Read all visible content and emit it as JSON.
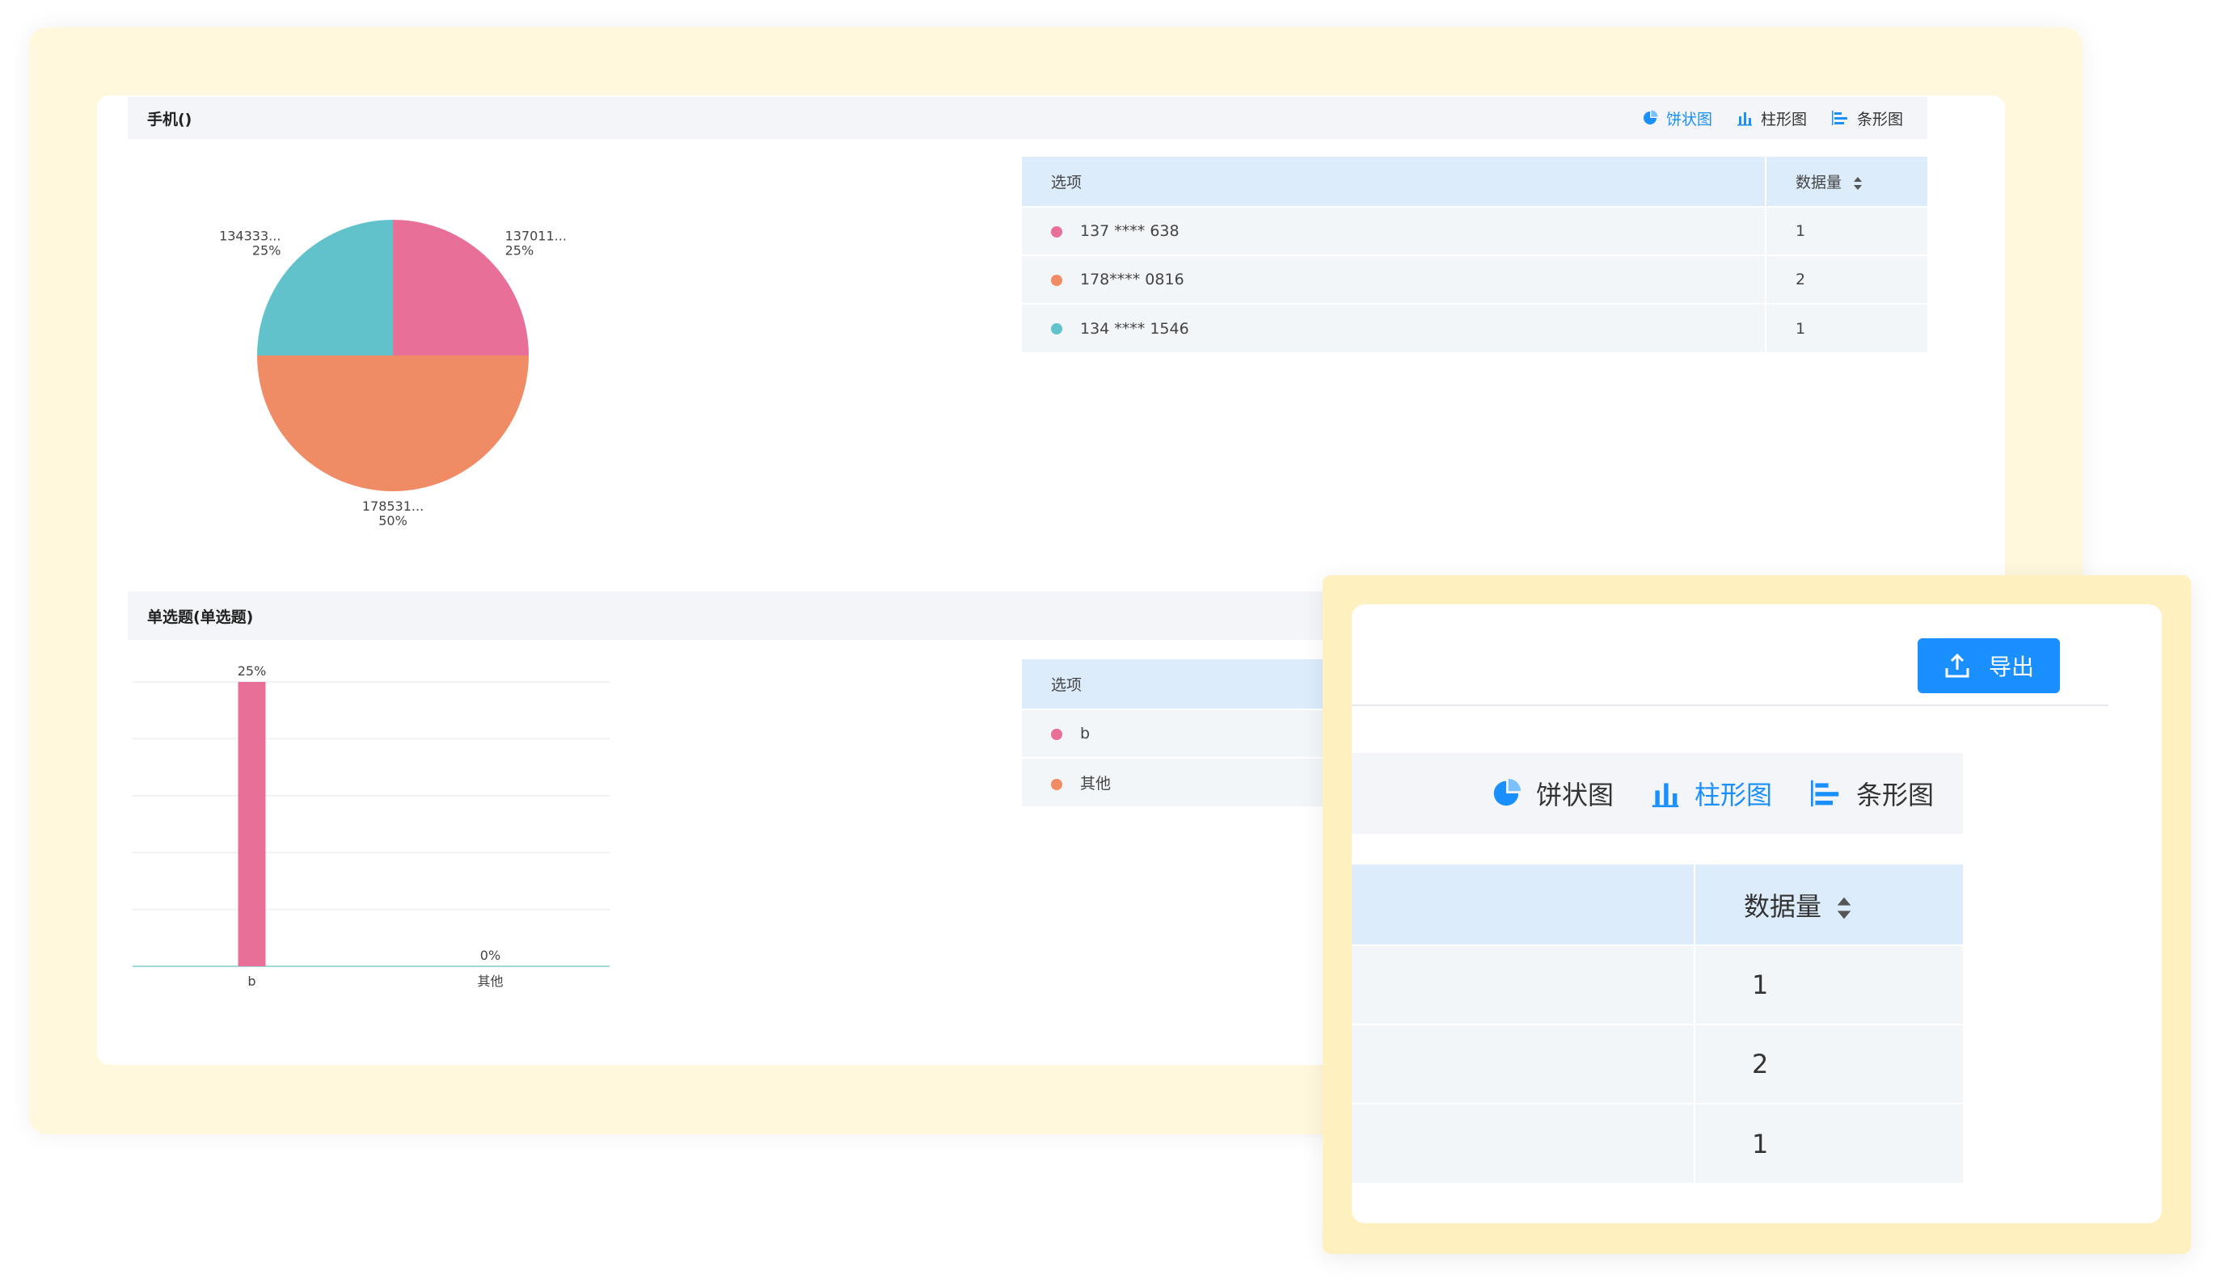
{
  "section1": {
    "title": "手机()",
    "switch": [
      {
        "label": "饼状图",
        "icon": "pie-chart-icon",
        "active": true
      },
      {
        "label": "柱形图",
        "icon": "bar-chart-icon",
        "active": false
      },
      {
        "label": "条形图",
        "icon": "horizontal-bar-icon",
        "active": false
      }
    ],
    "table": {
      "headers": [
        "选项",
        "数据量"
      ],
      "rows": [
        {
          "option": "137 **** 638",
          "count": "1",
          "color": "#e87098"
        },
        {
          "option": "178**** 0816",
          "count": "2",
          "color": "#f08c65"
        },
        {
          "option": "134 **** 1546",
          "count": "1",
          "color": "#62c2cb"
        }
      ]
    }
  },
  "section2": {
    "title": "单选题(单选题)",
    "table": {
      "headers": [
        "选项"
      ],
      "rows": [
        {
          "option": "b",
          "color": "#e87098"
        },
        {
          "option": "其他",
          "color": "#f08c65"
        }
      ]
    }
  },
  "chart_data": [
    {
      "type": "pie",
      "slices": [
        {
          "label": "137011...",
          "percent_label": "25%",
          "value": 25,
          "color": "#e87098"
        },
        {
          "label": "178531...",
          "percent_label": "50%",
          "value": 50,
          "color": "#f08c65"
        },
        {
          "label": "134333...",
          "percent_label": "25%",
          "value": 25,
          "color": "#62c2cb"
        }
      ]
    },
    {
      "type": "bar",
      "categories": [
        "b",
        "其他"
      ],
      "values": [
        25,
        0
      ],
      "data_labels": [
        "25%",
        "0%"
      ],
      "colors": [
        "#e87098",
        "#f08c65"
      ],
      "ylim": [
        0,
        25
      ],
      "grid": true
    }
  ],
  "overlay": {
    "export_label": "导出",
    "switch": [
      {
        "label": "饼状图",
        "icon": "pie-chart-icon",
        "active": false
      },
      {
        "label": "柱形图",
        "icon": "bar-chart-icon",
        "active": true
      },
      {
        "label": "条形图",
        "icon": "horizontal-bar-icon",
        "active": false
      }
    ],
    "table": {
      "header_count": "数据量",
      "counts": [
        "1",
        "2",
        "1"
      ]
    }
  },
  "colors": {
    "accent": "#1a8fff",
    "header_bg": "#dcecfb",
    "row_bg": "#f3f6f9",
    "frame": "#fff8dc"
  }
}
